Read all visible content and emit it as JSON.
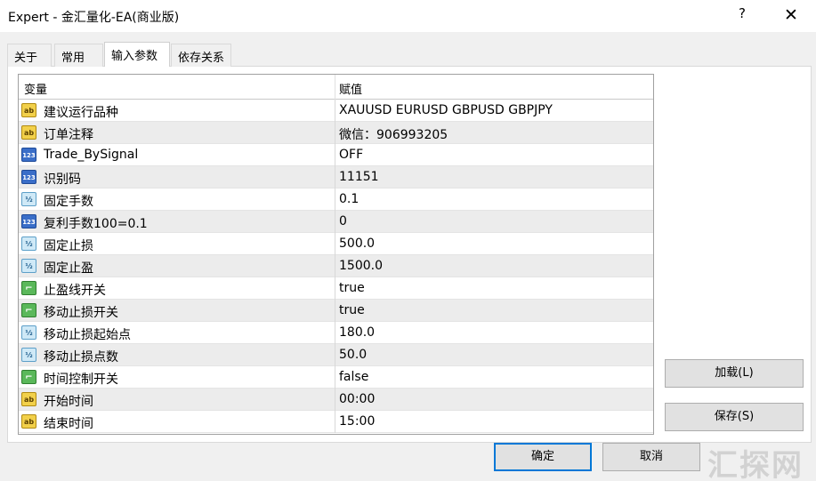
{
  "window": {
    "title": "Expert - 金汇量化-EA(商业版)",
    "help_label": "?",
    "close_label": "✕"
  },
  "tabs": [
    {
      "label": "关于"
    },
    {
      "label": "常用"
    },
    {
      "label": "输入参数"
    },
    {
      "label": "依存关系"
    }
  ],
  "grid": {
    "header_variable": "变量",
    "header_value": "赋值",
    "rows": [
      {
        "icon": "ab-string-icon",
        "name": "建议运行品种",
        "value": "XAUUSD EURUSD GBPUSD GBPJPY"
      },
      {
        "icon": "ab-string-icon",
        "name": "订单注释",
        "value": "微信：906993205"
      },
      {
        "icon": "123-integer-icon",
        "name": "Trade_BySignal",
        "value": "OFF"
      },
      {
        "icon": "123-integer-icon",
        "name": "识别码",
        "value": "11151"
      },
      {
        "icon": "fraction-double-icon",
        "name": "固定手数",
        "value": "0.1"
      },
      {
        "icon": "123-integer-icon",
        "name": "复利手数100=0.1",
        "value": "0"
      },
      {
        "icon": "fraction-double-icon",
        "name": "固定止损",
        "value": "500.0"
      },
      {
        "icon": "fraction-double-icon",
        "name": "固定止盈",
        "value": "1500.0"
      },
      {
        "icon": "bool-toggle-icon",
        "name": "止盈线开关",
        "value": "true"
      },
      {
        "icon": "bool-toggle-icon",
        "name": "移动止损开关",
        "value": "true"
      },
      {
        "icon": "fraction-double-icon",
        "name": "移动止损起始点",
        "value": "180.0"
      },
      {
        "icon": "fraction-double-icon",
        "name": "移动止损点数",
        "value": "50.0"
      },
      {
        "icon": "bool-toggle-icon",
        "name": "时间控制开关",
        "value": "false"
      },
      {
        "icon": "ab-string-icon",
        "name": "开始时间",
        "value": "00:00"
      },
      {
        "icon": "ab-string-icon",
        "name": "结束时间",
        "value": "15:00"
      }
    ]
  },
  "buttons": {
    "load": "加载(L)",
    "save": "保存(S)",
    "ok": "确定",
    "cancel": "取消"
  },
  "watermark": "汇探网",
  "colors": {
    "accent": "#0078d7",
    "row_alt": "#ececec"
  }
}
